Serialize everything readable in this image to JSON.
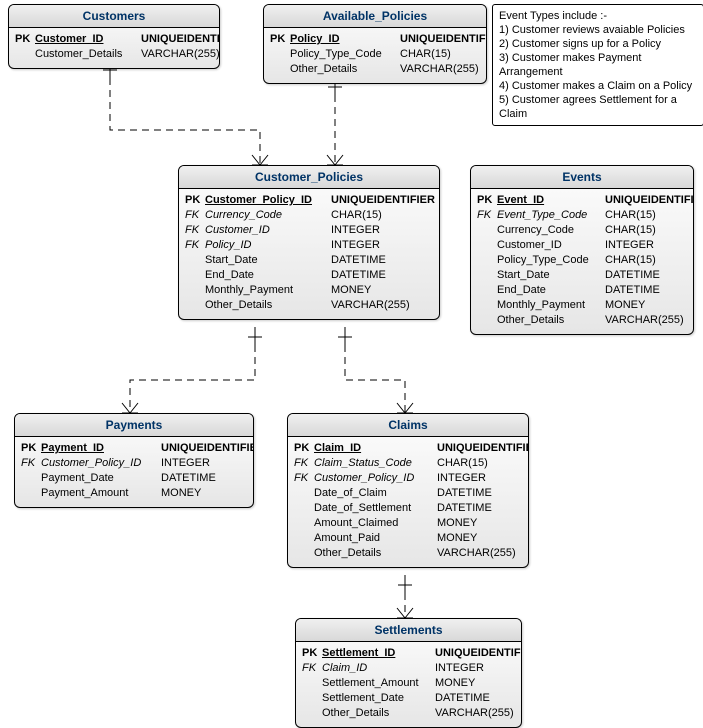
{
  "entities": {
    "customers": {
      "title": "Customers",
      "rows": [
        {
          "key": "PK",
          "name": "Customer_ID",
          "type": "UNIQUEIDENTIFIER",
          "pk": true
        },
        {
          "key": "",
          "name": "Customer_Details",
          "type": "VARCHAR(255)"
        }
      ]
    },
    "available_policies": {
      "title": "Available_Policies",
      "rows": [
        {
          "key": "PK",
          "name": "Policy_ID",
          "type": "UNIQUEIDENTIFIER",
          "pk": true
        },
        {
          "key": "",
          "name": "Policy_Type_Code",
          "type": "CHAR(15)"
        },
        {
          "key": "",
          "name": "Other_Details",
          "type": "VARCHAR(255)"
        }
      ]
    },
    "customer_policies": {
      "title": "Customer_Policies",
      "rows": [
        {
          "key": "PK",
          "name": "Customer_Policy_ID",
          "type": "UNIQUEIDENTIFIER",
          "pk": true
        },
        {
          "key": "FK",
          "name": "Currency_Code",
          "type": "CHAR(15)",
          "fk": true
        },
        {
          "key": "FK",
          "name": "Customer_ID",
          "type": "INTEGER",
          "fk": true
        },
        {
          "key": "FK",
          "name": "Policy_ID",
          "type": "INTEGER",
          "fk": true
        },
        {
          "key": "",
          "name": "Start_Date",
          "type": "DATETIME"
        },
        {
          "key": "",
          "name": "End_Date",
          "type": "DATETIME"
        },
        {
          "key": "",
          "name": "Monthly_Payment",
          "type": "MONEY"
        },
        {
          "key": "",
          "name": "Other_Details",
          "type": "VARCHAR(255)"
        }
      ]
    },
    "events": {
      "title": "Events",
      "rows": [
        {
          "key": "PK",
          "name": "Event_ID",
          "type": "UNIQUEIDENTIFIER",
          "pk": true
        },
        {
          "key": "FK",
          "name": "Event_Type_Code",
          "type": "CHAR(15)",
          "fk": true
        },
        {
          "key": "",
          "name": "Currency_Code",
          "type": "CHAR(15)"
        },
        {
          "key": "",
          "name": "Customer_ID",
          "type": "INTEGER"
        },
        {
          "key": "",
          "name": "Policy_Type_Code",
          "type": "CHAR(15)"
        },
        {
          "key": "",
          "name": "Start_Date",
          "type": "DATETIME"
        },
        {
          "key": "",
          "name": "End_Date",
          "type": "DATETIME"
        },
        {
          "key": "",
          "name": "Monthly_Payment",
          "type": "MONEY"
        },
        {
          "key": "",
          "name": "Other_Details",
          "type": "VARCHAR(255)"
        }
      ]
    },
    "payments": {
      "title": "Payments",
      "rows": [
        {
          "key": "PK",
          "name": "Payment_ID",
          "type": "UNIQUEIDENTIFIER",
          "pk": true
        },
        {
          "key": "FK",
          "name": "Customer_Policy_ID",
          "type": "INTEGER",
          "fk": true
        },
        {
          "key": "",
          "name": "Payment_Date",
          "type": "DATETIME"
        },
        {
          "key": "",
          "name": "Payment_Amount",
          "type": "MONEY"
        }
      ]
    },
    "claims": {
      "title": "Claims",
      "rows": [
        {
          "key": "PK",
          "name": "Claim_ID",
          "type": "UNIQUEIDENTIFIER",
          "pk": true
        },
        {
          "key": "FK",
          "name": "Claim_Status_Code",
          "type": "CHAR(15)",
          "fk": true
        },
        {
          "key": "FK",
          "name": "Customer_Policy_ID",
          "type": "INTEGER",
          "fk": true
        },
        {
          "key": "",
          "name": "Date_of_Claim",
          "type": "DATETIME"
        },
        {
          "key": "",
          "name": "Date_of_Settlement",
          "type": "DATETIME"
        },
        {
          "key": "",
          "name": "Amount_Claimed",
          "type": "MONEY"
        },
        {
          "key": "",
          "name": "Amount_Paid",
          "type": "MONEY"
        },
        {
          "key": "",
          "name": "Other_Details",
          "type": "VARCHAR(255)"
        }
      ]
    },
    "settlements": {
      "title": "Settlements",
      "rows": [
        {
          "key": "PK",
          "name": "Settlement_ID",
          "type": "UNIQUEIDENTIFIER",
          "pk": true
        },
        {
          "key": "FK",
          "name": "Claim_ID",
          "type": "INTEGER",
          "fk": true
        },
        {
          "key": "",
          "name": "Settlement_Amount",
          "type": "MONEY"
        },
        {
          "key": "",
          "name": "Settlement_Date",
          "type": "DATETIME"
        },
        {
          "key": "",
          "name": "Other_Details",
          "type": "VARCHAR(255)"
        }
      ]
    }
  },
  "note": {
    "title": "Event Types include :-",
    "lines": [
      "1) Customer reviews avaiable Policies",
      "2) Customer signs up for a Policy",
      "3) Customer makes Payment Arrangement",
      "4) Customer makes a Claim on a Policy",
      "5) Customer agrees Settlement for a Claim"
    ]
  },
  "chart_data": {
    "type": "table",
    "description": "Entity-Relationship Diagram for insurance customers/policies/claims",
    "entities": [
      "Customers",
      "Available_Policies",
      "Customer_Policies",
      "Events",
      "Payments",
      "Claims",
      "Settlements"
    ],
    "relationships": [
      {
        "from": "Customers",
        "to": "Customer_Policies",
        "cardinality": "1..*",
        "identifying": false
      },
      {
        "from": "Available_Policies",
        "to": "Customer_Policies",
        "cardinality": "1..*",
        "identifying": false
      },
      {
        "from": "Customer_Policies",
        "to": "Payments",
        "cardinality": "1..*",
        "identifying": false
      },
      {
        "from": "Customer_Policies",
        "to": "Claims",
        "cardinality": "1..*",
        "identifying": false
      },
      {
        "from": "Claims",
        "to": "Settlements",
        "cardinality": "1..*",
        "identifying": false
      }
    ]
  }
}
